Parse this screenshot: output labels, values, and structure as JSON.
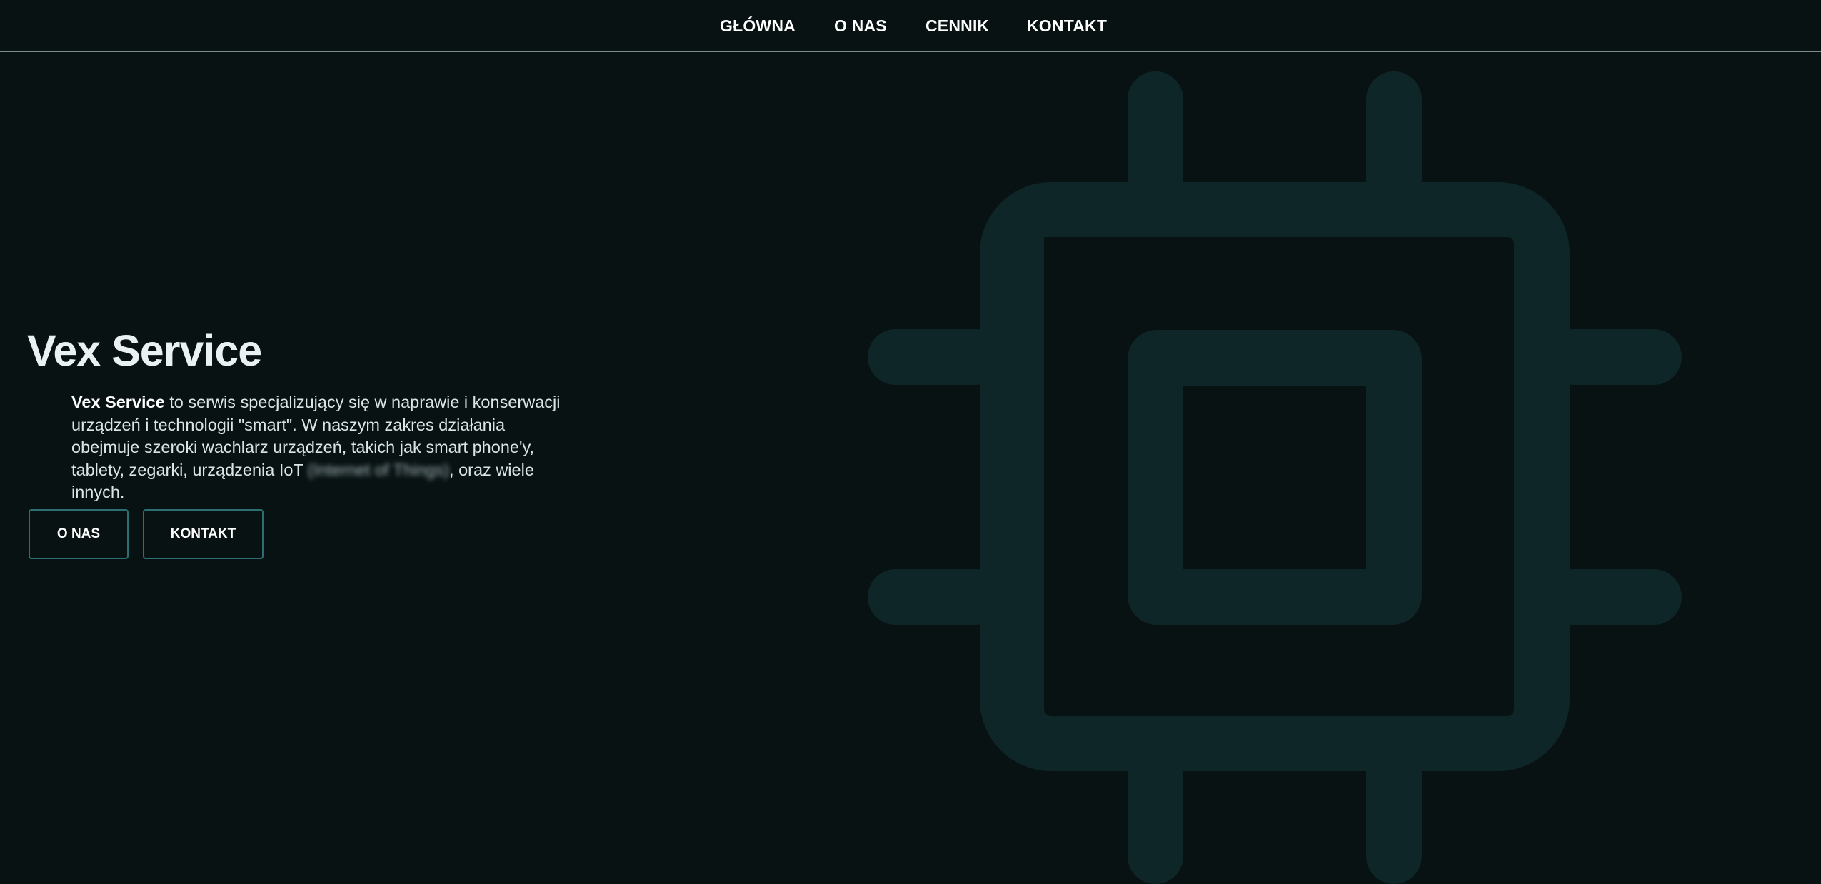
{
  "nav": {
    "items": [
      {
        "label": "GŁÓWNA"
      },
      {
        "label": "O NAS"
      },
      {
        "label": "CENNIK"
      },
      {
        "label": "KONTAKT"
      }
    ]
  },
  "hero": {
    "title": "Vex Service",
    "description": {
      "brand": "Vex Service",
      "text_before": " to serwis specjalizujący się w naprawie i konserwacji urządzeń i technologii \"smart\". W naszym zakres działania obejmuje szeroki wachlarz urządzeń, takich jak smart phone'y, tablety, zegarki, urządzenia IoT ",
      "blurred": "(Internet of Things)",
      "text_after": ", oraz wiele innych."
    },
    "buttons": {
      "about_label": "O NAS",
      "contact_label": "KONTAKT"
    }
  },
  "graphic": {
    "icon": "cpu-chip-icon",
    "color": "#0e2627"
  },
  "colors": {
    "background": "#091213",
    "button_border": "#2b6f72",
    "nav_divider": "#7b8c8f"
  }
}
